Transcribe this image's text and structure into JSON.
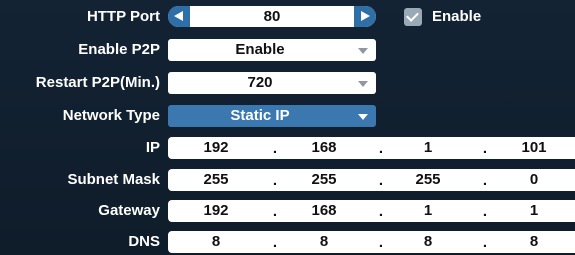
{
  "http_port": {
    "label": "HTTP Port",
    "value": "80",
    "enable_label": "Enable",
    "enable_checked": true
  },
  "enable_p2p": {
    "label": "Enable P2P",
    "value": "Enable"
  },
  "restart_p2p": {
    "label": "Restart P2P(Min.)",
    "value": "720"
  },
  "network_type": {
    "label": "Network Type",
    "value": "Static IP"
  },
  "ip": {
    "label": "IP",
    "octets": [
      "192",
      "168",
      "1",
      "101"
    ]
  },
  "subnet_mask": {
    "label": "Subnet Mask",
    "octets": [
      "255",
      "255",
      "255",
      "0"
    ]
  },
  "gateway": {
    "label": "Gateway",
    "octets": [
      "192",
      "168",
      "1",
      "1"
    ]
  },
  "dns": {
    "label": "DNS",
    "octets": [
      "8",
      "8",
      "8",
      "8"
    ]
  },
  "separator": ".",
  "colors": {
    "background": "#132334",
    "accent": "#3b78b0",
    "spinner_button": "#2f6fa8",
    "field": "#ffffff"
  },
  "icons": {
    "spinner_left": "triangle-left-icon",
    "spinner_right": "triangle-right-icon",
    "dropdown": "chevron-down-icon",
    "checkbox": "check-icon"
  }
}
